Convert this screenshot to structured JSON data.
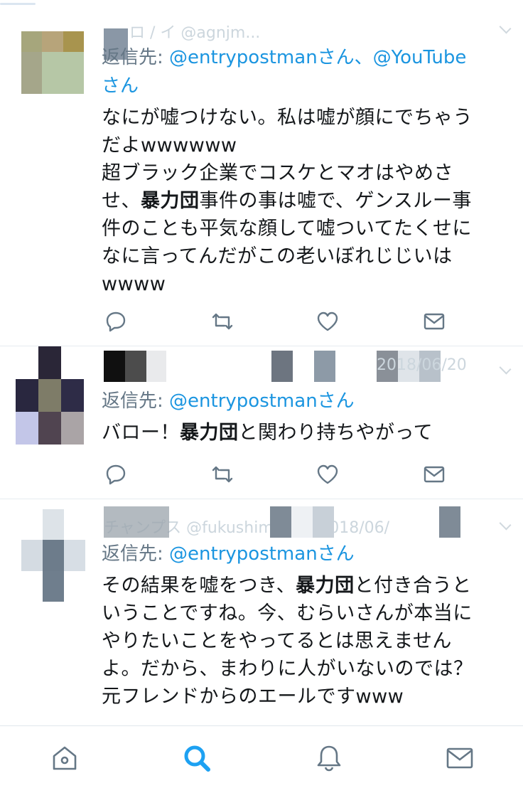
{
  "tweets": [
    {
      "header_faint": "ロ / イ @agnjm...",
      "reply_prefix": "返信先: ",
      "reply_mentions": "@entrypostmanさん、@YouTube",
      "reply_mentions_2": "さん",
      "lines": [
        "なにが嘘つけない。私は嘘が顔にでちゃう",
        "だよwwwwww",
        "超ブラック企業でコスケとマオはやめさ"
      ],
      "line4_before": "せ、",
      "line4_bold": "暴力団",
      "line4_after": "事件の事は嘘で、ゲンスルー事",
      "lines_tail": [
        "件のことも平気な顔して嘘ついてたくせに",
        "なに言ってんだがこの老いぼれじじいは",
        "wwww"
      ]
    },
    {
      "header_faint": "2018/06/20",
      "reply_prefix": "返信先: ",
      "reply_mentions": "@entrypostmanさん",
      "text_before": "バロー！",
      "text_bold": "暴力団",
      "text_after": "と関わり持ちやがって"
    },
    {
      "header_faint": "チャンプス @fukushimaru... 2018/06/",
      "reply_prefix": "返信先: ",
      "reply_mentions": "@entrypostmanさん",
      "line1_before": "その結果を嘘をつき、",
      "line1_bold": "暴力団",
      "line1_after": "と付き合うと",
      "lines_tail": [
        "いうことですね。今、むらいさんが本当に",
        "やりたいことをやってるとは思えません",
        "よ。だから、まわりに人がいないのでは？",
        "元フレンドからのエールですwww"
      ]
    }
  ],
  "icons": {
    "reply": "reply-icon",
    "retweet": "retweet-icon",
    "like": "heart-icon",
    "dm": "envelope-icon",
    "home": "home-icon",
    "search": "search-icon",
    "notifications": "bell-icon",
    "messages": "mail-icon"
  },
  "colors": {
    "accent": "#1da1f2",
    "mention": "#1b95e0",
    "muted": "#657786",
    "icon": "#657786"
  }
}
